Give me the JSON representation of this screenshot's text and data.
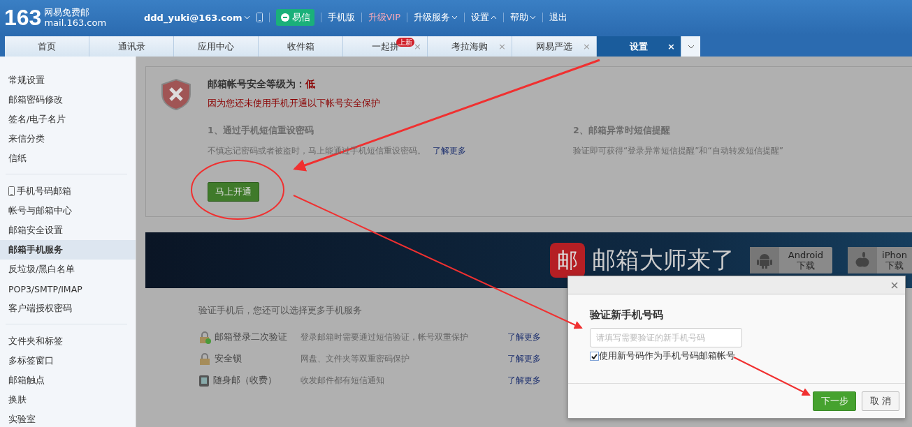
{
  "header": {
    "logo_number": "163",
    "logo_title": "网易免费邮",
    "logo_domain": "mail.163.com",
    "user": "ddd_yuki@163.com",
    "yixin": "易信",
    "links": [
      {
        "label": "手机版",
        "kind": "plain"
      },
      {
        "label": "升级VIP",
        "kind": "vip"
      },
      {
        "label": "升级服务",
        "kind": "down"
      },
      {
        "label": "设置",
        "kind": "up"
      },
      {
        "label": "帮助",
        "kind": "down"
      },
      {
        "label": "退出",
        "kind": "plain"
      }
    ]
  },
  "tabs": [
    {
      "label": "首页",
      "selected": false
    },
    {
      "label": "通讯录",
      "selected": false
    },
    {
      "label": "应用中心",
      "selected": false
    },
    {
      "label": "收件箱",
      "selected": false
    },
    {
      "label": "一起拼",
      "selected": false,
      "close": "×",
      "badge": "上新"
    },
    {
      "label": "考拉海购",
      "selected": false,
      "close": "×"
    },
    {
      "label": "网易严选",
      "selected": false,
      "close": "×"
    },
    {
      "label": "设置",
      "selected": true,
      "close": "×"
    }
  ],
  "sidebar": {
    "groups": [
      {
        "items": [
          {
            "label": "常规设置",
            "selected": false
          },
          {
            "label": "邮箱密码修改",
            "selected": false
          },
          {
            "label": "签名/电子名片",
            "selected": false
          },
          {
            "label": "来信分类",
            "selected": false
          },
          {
            "label": "信纸",
            "selected": false
          }
        ]
      },
      {
        "items": [
          {
            "label": "手机号码邮箱",
            "selected": false,
            "kind": "phone"
          },
          {
            "label": "帐号与邮箱中心",
            "selected": false,
            "kind": "text"
          },
          {
            "label": "邮箱安全设置",
            "selected": false,
            "kind": "text"
          },
          {
            "label": "邮箱手机服务",
            "selected": true,
            "kind": "text"
          },
          {
            "label": "反垃圾/黑白名单",
            "selected": false,
            "kind": "text"
          },
          {
            "label": "POP3/SMTP/IMAP",
            "selected": false,
            "kind": "text"
          },
          {
            "label": "客户端授权密码",
            "selected": false,
            "kind": "text"
          }
        ]
      },
      {
        "items": [
          {
            "label": "文件夹和标签",
            "selected": false
          },
          {
            "label": "多标签窗口",
            "selected": false
          },
          {
            "label": "邮箱触点",
            "selected": false
          },
          {
            "label": "换肤",
            "selected": false
          },
          {
            "label": "实验室",
            "selected": false
          }
        ]
      }
    ]
  },
  "security": {
    "title": "邮箱帐号安全等级为：",
    "level": "低",
    "warning": "因为您还未使用手机开通以下帐号安全保护",
    "features": [
      {
        "title": "1、通过手机短信重设密码",
        "description": "不慎忘记密码或者被盗时，马上能通过手机短信重设密码。",
        "link": "了解更多"
      },
      {
        "title": "2、邮箱异常时短信提醒",
        "description": "验证即可获得“登录异常短信提醒”和“自动转发短信提醒”"
      }
    ],
    "button": "马上开通"
  },
  "banner": {
    "logo_char": "邮",
    "slogan": "邮箱大师来了",
    "downloads": [
      {
        "kind": "android",
        "name": "Android",
        "action": "下载"
      },
      {
        "kind": "apple",
        "name": "iPhon",
        "action": "下载"
      }
    ]
  },
  "services": {
    "intro": "验证手机后，您还可以选择更多手机服务",
    "rows": [
      {
        "kind": "twostep",
        "name": "邮箱登录二次验证",
        "description": "登录邮箱时需要通过短信验证，帐号双重保护",
        "link": "了解更多"
      },
      {
        "kind": "lock",
        "name": "安全锁",
        "description": "网盘、文件夹等双重密码保护",
        "link": "了解更多"
      },
      {
        "kind": "phone",
        "name": "随身邮（收费）",
        "description": "收发邮件都有短信通知",
        "link": "了解更多"
      }
    ]
  },
  "dialog": {
    "title": "验证新手机号码",
    "placeholder": "请填写需要验证的新手机号码",
    "checkbox": {
      "label": "使用新号码作为手机号码邮箱帐号",
      "checked": true
    },
    "primary": "下一步",
    "cancel": "取 消"
  }
}
